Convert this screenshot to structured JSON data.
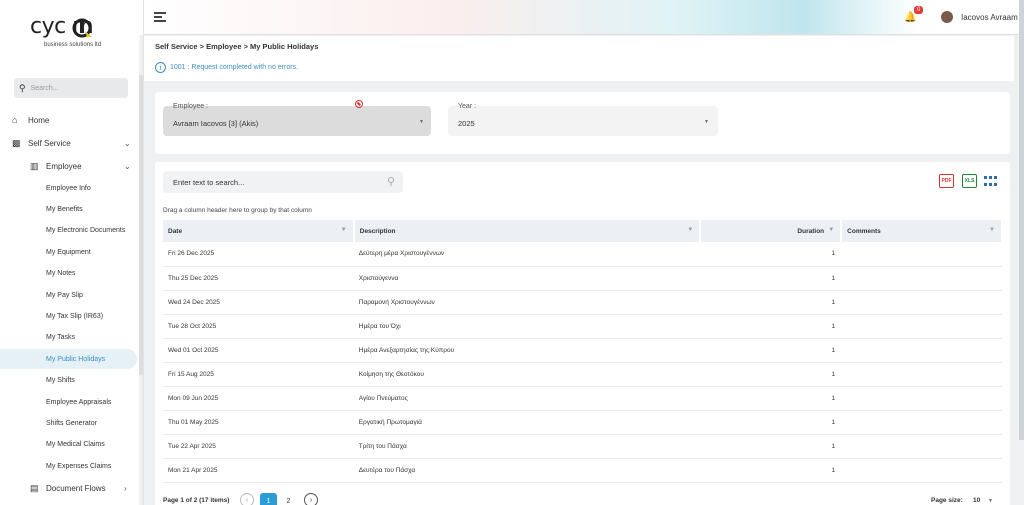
{
  "logo": {
    "word": "cyc  m",
    "sub": "business solutions ltd"
  },
  "sidebar": {
    "search_placeholder": "Search...",
    "home": "Home",
    "self_service": "Self Service",
    "employee": "Employee",
    "items": [
      "Employee Info",
      "My Benefits",
      "My Electronic Documents",
      "My Equipment",
      "My Notes",
      "My Pay Slip",
      "My Tax Slip (IR63)",
      "My Tasks",
      "My Public Holidays",
      "My Shifts",
      "Employee Appraisals",
      "Shifts Generator",
      "My Medical Claims",
      "My Expenses Claims"
    ],
    "active_index": 8,
    "document_flows": "Document Flows"
  },
  "topbar": {
    "notification_count": "0",
    "user_name": "Iacovos Avraam"
  },
  "breadcrumb": "Self Service > Employee > My Public Holidays",
  "status_message": "1001 : Request completed with no errors.",
  "filters": {
    "employee_label": "Employee :",
    "employee_value": "Avraam Iacovos [3] (Akis)",
    "year_label": "Year :",
    "year_value": "2025"
  },
  "grid": {
    "search_placeholder": "Enter text to search...",
    "group_hint": "Drag a column header here to group by that column",
    "export_pdf": "PDF",
    "export_xls": "XLS",
    "columns": [
      "Date",
      "Description",
      "Duration",
      "Comments"
    ],
    "rows": [
      [
        "Fri 26 Dec 2025",
        "Δεύτερη μέρα Χριστουγέννων",
        "1",
        ""
      ],
      [
        "Thu 25 Dec 2025",
        "Χριστούγεννα",
        "1",
        ""
      ],
      [
        "Wed 24 Dec 2025",
        "Παραμονή Χριστουγέννων",
        "1",
        ""
      ],
      [
        "Tue 28 Oct 2025",
        "Ημέρα του Όχι",
        "1",
        ""
      ],
      [
        "Wed 01 Oct 2025",
        "Ημέρα Ανεξαρτησίας της Κύπρου",
        "1",
        ""
      ],
      [
        "Fri 15 Aug 2025",
        "Κοίμηση της Θεοτόκου",
        "1",
        ""
      ],
      [
        "Mon 09 Jun 2025",
        "Αγίου Πνεύματος",
        "1",
        ""
      ],
      [
        "Thu 01 May 2025",
        "Εργατική Πρωτομαγιά",
        "1",
        ""
      ],
      [
        "Tue 22 Apr 2025",
        "Τρίτη του Πάσχα",
        "1",
        ""
      ],
      [
        "Mon 21 Apr 2025",
        "Δευτέρα του Πάσχα",
        "1",
        ""
      ]
    ],
    "pager": {
      "info": "Page 1 of 2 (17 items)",
      "pages": [
        "1",
        "2"
      ],
      "current": "1",
      "size_label": "Page size:",
      "size_value": "10"
    }
  }
}
